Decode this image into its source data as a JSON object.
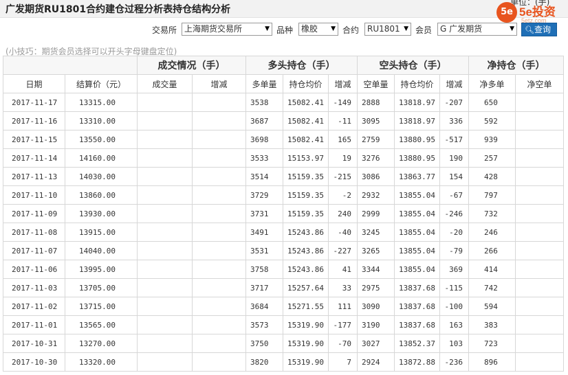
{
  "header": {
    "title": "广发期货RU1801合约建仓过程分析表持仓结构分析",
    "unit": "单位：(手)",
    "logo_mark": "5e",
    "logo_text": "5e投资",
    "logo_sub": "5etz.com"
  },
  "filters": {
    "exchange_label": "交易所",
    "exchange_value": "上海期货交易所",
    "variety_label": "品种",
    "variety_value": "橡胶",
    "contract_label": "合约",
    "contract_value": "RU1801",
    "member_label": "会员",
    "member_value": "G 广发期货",
    "query_label": "查询"
  },
  "tip": "(小技巧：期货会员选择可以开头字母键盘定位)",
  "table": {
    "groups": [
      "成交情况（手）",
      "多头持仓（手）",
      "空头持仓（手）",
      "净持仓（手）"
    ],
    "columns": [
      "日期",
      "结算价（元）",
      "成交量",
      "增减",
      "多单量",
      "持仓均价",
      "增减",
      "空单量",
      "持仓均价",
      "增减",
      "净多单",
      "净空单"
    ],
    "rows": [
      {
        "date": "2017-11-17",
        "price": "13315.00",
        "vol": "",
        "vol_chg": "",
        "long": "3538",
        "long_avg": "15082.41",
        "long_chg": "-149",
        "short": "2888",
        "short_avg": "13818.97",
        "short_chg": "-207",
        "net_long": "650",
        "net_short": ""
      },
      {
        "date": "2017-11-16",
        "price": "13310.00",
        "vol": "",
        "vol_chg": "",
        "long": "3687",
        "long_avg": "15082.41",
        "long_chg": "-11",
        "short": "3095",
        "short_avg": "13818.97",
        "short_chg": "336",
        "net_long": "592",
        "net_short": ""
      },
      {
        "date": "2017-11-15",
        "price": "13550.00",
        "vol": "",
        "vol_chg": "",
        "long": "3698",
        "long_avg": "15082.41",
        "long_chg": "165",
        "short": "2759",
        "short_avg": "13880.95",
        "short_chg": "-517",
        "net_long": "939",
        "net_short": ""
      },
      {
        "date": "2017-11-14",
        "price": "14160.00",
        "vol": "",
        "vol_chg": "",
        "long": "3533",
        "long_avg": "15153.97",
        "long_chg": "19",
        "short": "3276",
        "short_avg": "13880.95",
        "short_chg": "190",
        "net_long": "257",
        "net_short": ""
      },
      {
        "date": "2017-11-13",
        "price": "14030.00",
        "vol": "",
        "vol_chg": "",
        "long": "3514",
        "long_avg": "15159.35",
        "long_chg": "-215",
        "short": "3086",
        "short_avg": "13863.77",
        "short_chg": "154",
        "net_long": "428",
        "net_short": ""
      },
      {
        "date": "2017-11-10",
        "price": "13860.00",
        "vol": "",
        "vol_chg": "",
        "long": "3729",
        "long_avg": "15159.35",
        "long_chg": "-2",
        "short": "2932",
        "short_avg": "13855.04",
        "short_chg": "-67",
        "net_long": "797",
        "net_short": ""
      },
      {
        "date": "2017-11-09",
        "price": "13930.00",
        "vol": "",
        "vol_chg": "",
        "long": "3731",
        "long_avg": "15159.35",
        "long_chg": "240",
        "short": "2999",
        "short_avg": "13855.04",
        "short_chg": "-246",
        "net_long": "732",
        "net_short": ""
      },
      {
        "date": "2017-11-08",
        "price": "13915.00",
        "vol": "",
        "vol_chg": "",
        "long": "3491",
        "long_avg": "15243.86",
        "long_chg": "-40",
        "short": "3245",
        "short_avg": "13855.04",
        "short_chg": "-20",
        "net_long": "246",
        "net_short": ""
      },
      {
        "date": "2017-11-07",
        "price": "14040.00",
        "vol": "",
        "vol_chg": "",
        "long": "3531",
        "long_avg": "15243.86",
        "long_chg": "-227",
        "short": "3265",
        "short_avg": "13855.04",
        "short_chg": "-79",
        "net_long": "266",
        "net_short": ""
      },
      {
        "date": "2017-11-06",
        "price": "13995.00",
        "vol": "",
        "vol_chg": "",
        "long": "3758",
        "long_avg": "15243.86",
        "long_chg": "41",
        "short": "3344",
        "short_avg": "13855.04",
        "short_chg": "369",
        "net_long": "414",
        "net_short": ""
      },
      {
        "date": "2017-11-03",
        "price": "13705.00",
        "vol": "",
        "vol_chg": "",
        "long": "3717",
        "long_avg": "15257.64",
        "long_chg": "33",
        "short": "2975",
        "short_avg": "13837.68",
        "short_chg": "-115",
        "net_long": "742",
        "net_short": ""
      },
      {
        "date": "2017-11-02",
        "price": "13715.00",
        "vol": "",
        "vol_chg": "",
        "long": "3684",
        "long_avg": "15271.55",
        "long_chg": "111",
        "short": "3090",
        "short_avg": "13837.68",
        "short_chg": "-100",
        "net_long": "594",
        "net_short": ""
      },
      {
        "date": "2017-11-01",
        "price": "13565.00",
        "vol": "",
        "vol_chg": "",
        "long": "3573",
        "long_avg": "15319.90",
        "long_chg": "-177",
        "short": "3190",
        "short_avg": "13837.68",
        "short_chg": "163",
        "net_long": "383",
        "net_short": ""
      },
      {
        "date": "2017-10-31",
        "price": "13270.00",
        "vol": "",
        "vol_chg": "",
        "long": "3750",
        "long_avg": "15319.90",
        "long_chg": "-70",
        "short": "3027",
        "short_avg": "13852.37",
        "short_chg": "103",
        "net_long": "723",
        "net_short": ""
      },
      {
        "date": "2017-10-30",
        "price": "13320.00",
        "vol": "",
        "vol_chg": "",
        "long": "3820",
        "long_avg": "15319.90",
        "long_chg": "7",
        "short": "2924",
        "short_avg": "13872.88",
        "short_chg": "-236",
        "net_long": "896",
        "net_short": ""
      }
    ]
  },
  "colors": {
    "increase": "#e60000",
    "decrease": "#009900",
    "brand": "#e8541e",
    "button": "#1f6fb6"
  }
}
